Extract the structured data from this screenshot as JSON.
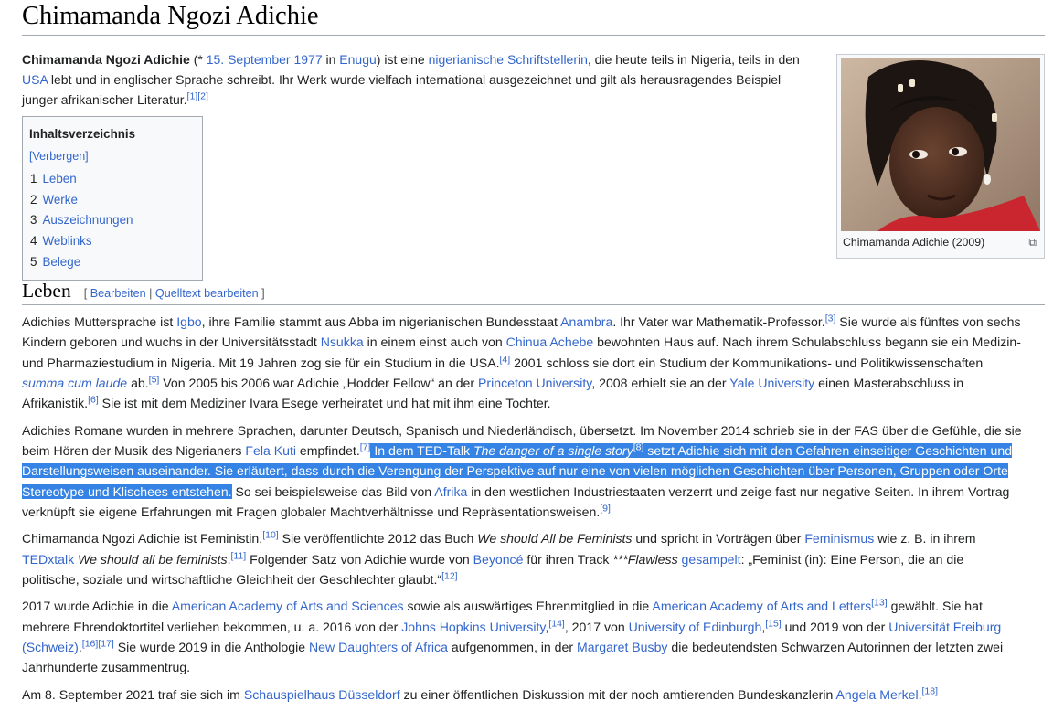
{
  "title": "Chimamanda Ngozi Adichie",
  "lead": {
    "name": "Chimamanda Ngozi Adichie",
    "t1": " (* ",
    "birth_date": "15. September 1977",
    "t2": " in ",
    "birthplace": "Enugu",
    "t3": ") ist eine ",
    "nationality_link": "nigerianische Schriftstellerin",
    "t4": ", die heute teils in Nigeria, teils in den ",
    "usa": "USA",
    "t5": " lebt und in englischer Sprache schreibt. Ihr Werk wurde vielfach international ausgezeichnet und gilt als herausragendes Beispiel junger afrikanischer Literatur.",
    "ref1": "[1]",
    "ref2": "[2]"
  },
  "toc": {
    "title": "Inhaltsverzeichnis",
    "toggle": "[Verbergen]",
    "items": [
      {
        "num": "1",
        "label": "Leben"
      },
      {
        "num": "2",
        "label": "Werke"
      },
      {
        "num": "3",
        "label": "Auszeichnungen"
      },
      {
        "num": "4",
        "label": "Weblinks"
      },
      {
        "num": "5",
        "label": "Belege"
      }
    ]
  },
  "infobox": {
    "caption": "Chimamanda Adichie (2009)",
    "magnify_icon": "magnify-icon"
  },
  "section": {
    "heading": "Leben",
    "edit_open": "[ ",
    "edit_label": "Bearbeiten",
    "edit_sep": " | ",
    "source_edit_label": "Quelltext bearbeiten",
    "edit_close": " ]"
  },
  "p1": {
    "t1": "Adichies Muttersprache ist ",
    "igbo": "Igbo",
    "t2": ", ihre Familie stammt aus Abba im nigerianischen Bundesstaat ",
    "anambra": "Anambra",
    "t3": ". Ihr Vater war Mathematik-Professor.",
    "ref3": "[3]",
    "t4": " Sie wurde als fünftes von sechs Kindern geboren und wuchs in der Universitätsstadt ",
    "nsukka": "Nsukka",
    "t5": " in einem einst auch von ",
    "achebe": "Chinua Achebe",
    "t6": " bewohnten Haus auf. Nach ihrem Schulabschluss begann sie ein Medizin- und Pharmaziestudium in Nigeria. Mit 19 Jahren zog sie für ein Studium in die USA.",
    "ref4": "[4]",
    "t7": " 2001 schloss sie dort ein Studium der Kommunikations- und Politikwissenschaften ",
    "summa": "summa cum laude",
    "t8": " ab.",
    "ref5": "[5]",
    "t9": " Von 2005 bis 2006 war Adichie „Hodder Fellow“ an der ",
    "princeton": "Princeton University",
    "t10": ", 2008 erhielt sie an der ",
    "yale": "Yale University",
    "t11": " einen Masterabschluss in Afrikanistik.",
    "ref6": "[6]",
    "t12": " Sie ist mit dem Mediziner Ivara Esege verheiratet und hat mit ihm eine Tochter."
  },
  "p2": {
    "t1": "Adichies Romane wurden in mehrere Sprachen, darunter Deutsch, Spanisch und Niederländisch, übersetzt. Im November 2014 schrieb sie in der FAS über die Gefühle, die sie beim Hören der Musik des Nigerianers ",
    "kuti": "Fela Kuti",
    "t2": " empfindet.",
    "ref7": "[7]",
    "hl1": " In dem TED-Talk ",
    "talk_title": "The danger of a single story",
    "ref8": "[8]",
    "hl2": " setzt Adichie sich mit den Gefahren einseitiger Geschichten und Darstellungsweisen auseinander. Sie erläutert, dass durch die Verengung der Perspektive auf nur eine von vielen möglichen Geschichten über Personen, Gruppen oder Orte Stereotype und Klischees entstehen.",
    "t3": " So sei beispielsweise das Bild von ",
    "afrika": "Afrika",
    "t4": " in den westlichen Industriestaaten verzerrt und zeige fast nur negative Seiten. In ihrem Vortrag verknüpft sie eigene Erfahrungen mit Fragen globaler Machtverhältnisse und Repräsentationsweisen.",
    "ref9": "[9]"
  },
  "p3": {
    "t1": "Chimamanda Ngozi Adichie ist Feministin.",
    "ref10": "[10]",
    "t2": " Sie veröffentlichte 2012 das Buch ",
    "book": "We should All be Feminists",
    "t3": " und spricht in Vorträgen über ",
    "feminismus": "Feminismus",
    "t4": " wie z. B. in ihrem ",
    "tedx": "TEDxtalk",
    "t5": " ",
    "tedx_title": "We should all be feminists",
    "t6": ".",
    "ref11": "[11]",
    "t7": " Folgender Satz von Adichie wurde von ",
    "beyonce": "Beyoncé",
    "t8": " für ihren Track ",
    "track": "***Flawless",
    "t9": " ",
    "sampled": "gesampelt",
    "t10": ": „Feminist (in): Eine Person, die an die politische, soziale und wirtschaftliche Gleichheit der Geschlechter glaubt.“",
    "ref12": "[12]"
  },
  "p4": {
    "t1": "2017 wurde Adichie in die ",
    "aaas": "American Academy of Arts and Sciences",
    "t2": " sowie als auswärtiges Ehrenmitglied in die ",
    "aaal": "American Academy of Arts and Letters",
    "ref13": "[13]",
    "t3": " gewählt. Sie hat mehrere Ehrendoktortitel verliehen bekommen, u. a. 2016 von der ",
    "jhu": "Johns Hopkins University",
    "t4": ",",
    "ref14": "[14]",
    "t5": ", 2017 von ",
    "edinburgh": "University of Edinburgh",
    "t6": ",",
    "ref15": "[15]",
    "t7": " und 2019 von der ",
    "freiburg": "Universität Freiburg (Schweiz)",
    "t8": ".",
    "ref16": "[16]",
    "ref17": "[17]",
    "t9": " Sie wurde 2019 in die Anthologie ",
    "ndoa": "New Daughters of Africa",
    "t10": " aufgenommen, in der ",
    "busby": "Margaret Busby",
    "t11": " die bedeutendsten Schwarzen Autorinnen der letzten zwei Jahrhunderte zusammentrug."
  },
  "p5": {
    "t1": "Am 8. September 2021 traf sie sich im ",
    "schauspielhaus": "Schauspielhaus Düsseldorf",
    "t2": " zu einer öffentlichen Diskussion mit der noch amtierenden Bundeskanzlerin ",
    "merkel": "Angela Merkel",
    "t3": ".",
    "ref18": "[18]"
  }
}
